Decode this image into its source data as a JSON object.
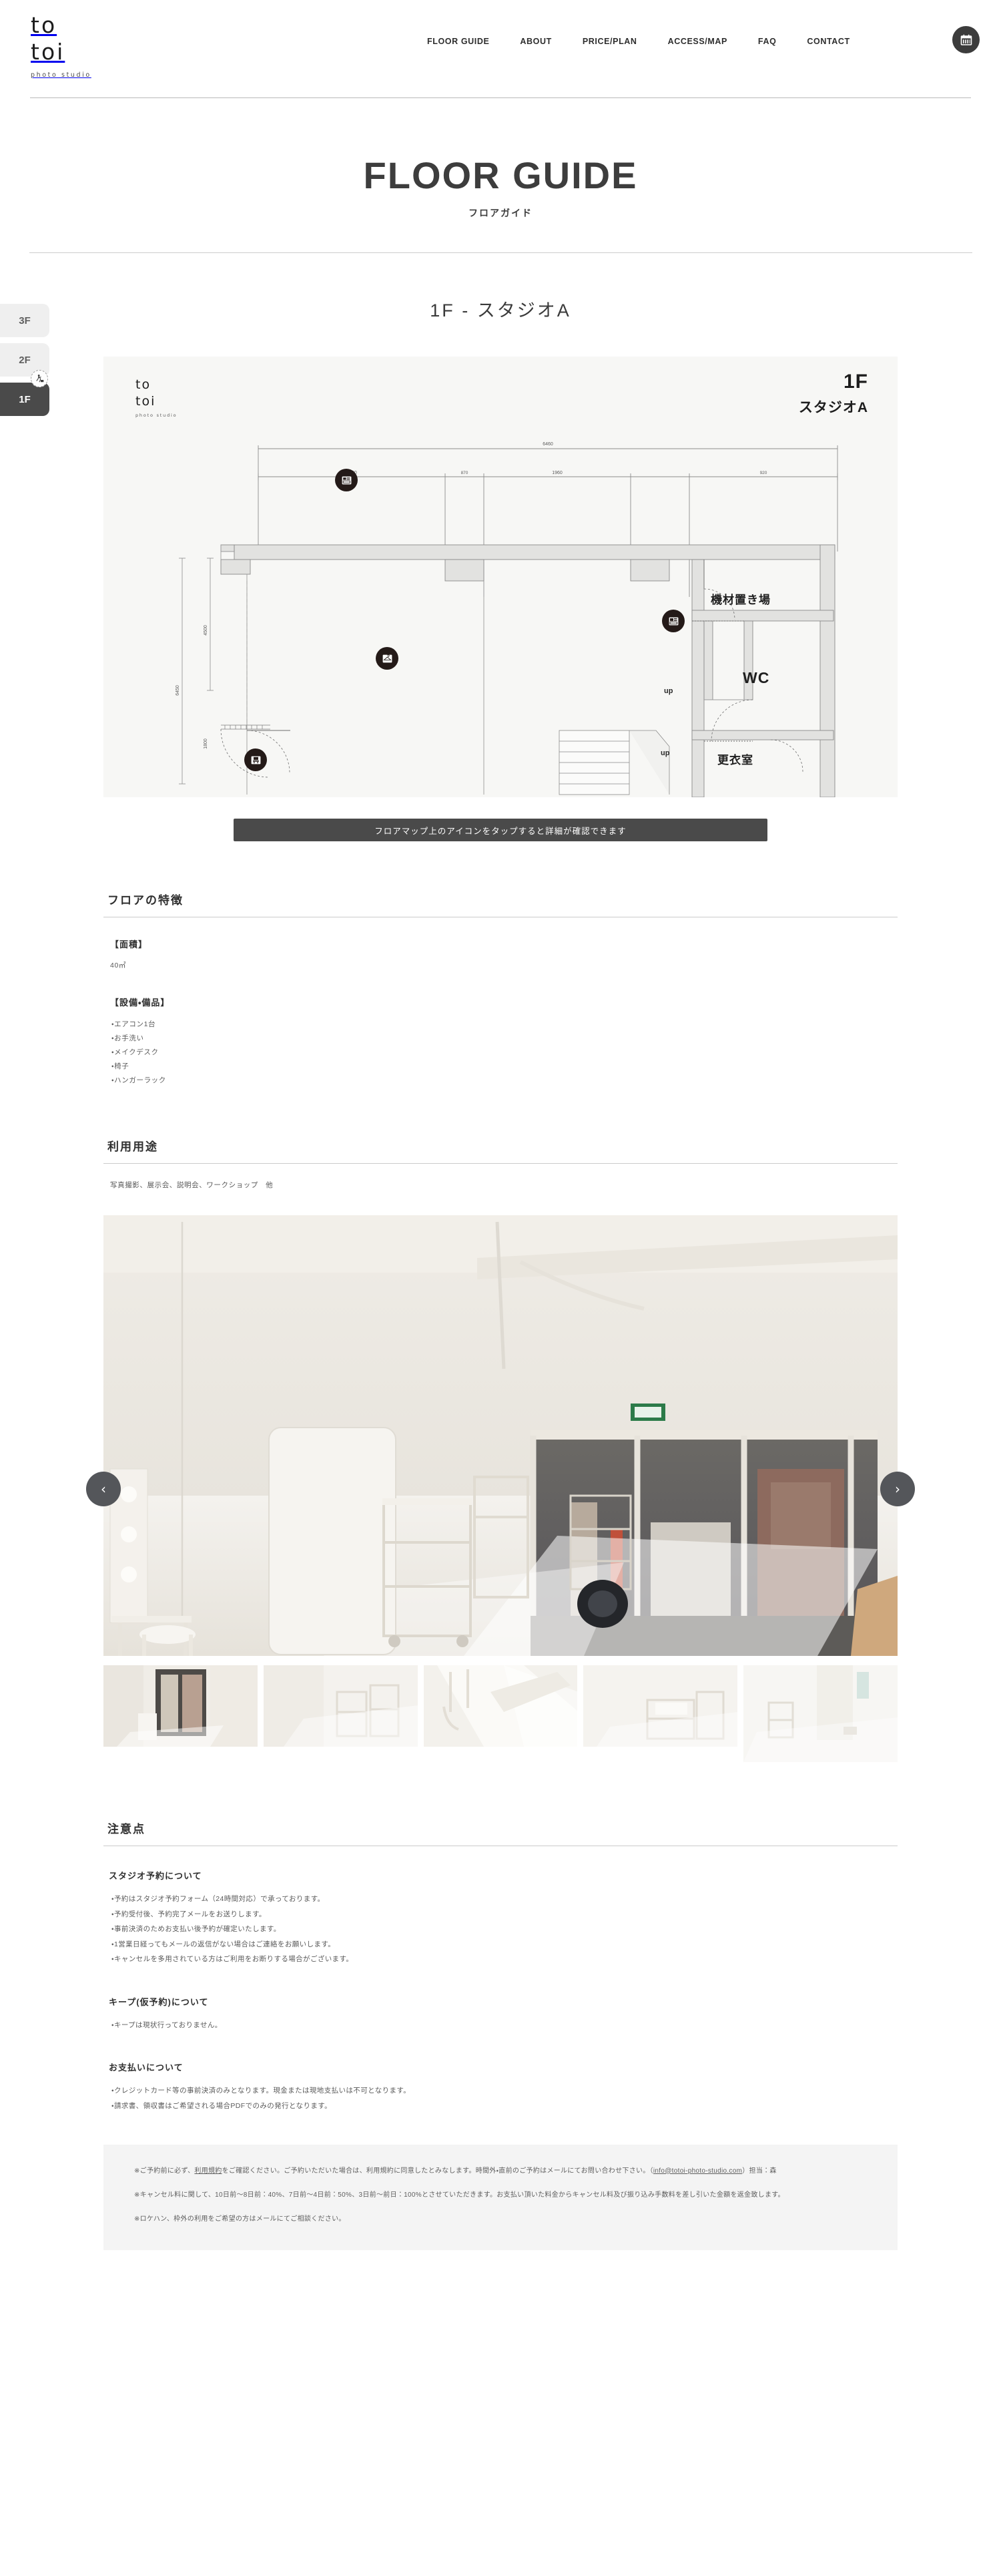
{
  "header": {
    "logo_line1": "to",
    "logo_line2": "toi",
    "logo_sub": "photo studio",
    "nav": [
      {
        "label": "FLOOR GUIDE"
      },
      {
        "label": "ABOUT"
      },
      {
        "label": "PRICE/PLAN"
      },
      {
        "label": "ACCESS/MAP"
      },
      {
        "label": "FAQ"
      },
      {
        "label": "CONTACT"
      }
    ],
    "reserve_icon": "calendar-icon"
  },
  "page": {
    "title": "FLOOR GUIDE",
    "subtitle": "フロアガイド"
  },
  "floor_tabs": [
    {
      "label": "3F",
      "active": false
    },
    {
      "label": "2F",
      "active": false
    },
    {
      "label": "1F",
      "active": true
    }
  ],
  "floor_section": {
    "title": "1F - スタジオA",
    "plan": {
      "logo_line1": "to",
      "logo_line2": "toi",
      "logo_sub": "photo studio",
      "floor_label": "1F",
      "room_label": "スタジオA",
      "rooms": [
        {
          "name": "機材置き場"
        },
        {
          "name": "WC"
        },
        {
          "name": "更衣室"
        }
      ],
      "stair_markers": [
        "up",
        "up"
      ],
      "dimensions": {
        "overall": "6460",
        "segments": [
          "2690",
          "870",
          "1960",
          "920"
        ],
        "side_overall": "6450",
        "side_segments": [
          "4500",
          "1800"
        ]
      },
      "pins": [
        {
          "name": "pin-makeup-desk"
        },
        {
          "name": "pin-hanger-rack"
        },
        {
          "name": "pin-equipment-storage"
        },
        {
          "name": "pin-chair"
        }
      ]
    },
    "tap_hint": "フロアマップ上のアイコンをタップすると詳細が確認できます"
  },
  "features": {
    "heading": "フロアの特徴",
    "area_label": "【面積】",
    "area_value": "40㎡",
    "equipment_label": "【設備・備品】",
    "equipment": [
      "・エアコン1台",
      "・お手洗い",
      "・メイクデスク",
      "・椅子",
      "・ハンガーラック"
    ]
  },
  "usage": {
    "heading": "利用用途",
    "text": "写真撮影、展示会、説明会、ワークショップ　他"
  },
  "gallery": {
    "prev_label": "‹",
    "next_label": "›",
    "thumb_count": 5
  },
  "notes": {
    "heading": "注意点",
    "groups": [
      {
        "title": "スタジオ予約について",
        "items": [
          "・予約はスタジオ予約フォーム（24時間対応）で承っております。",
          "・予約受付後、予約完了メールをお送りします。",
          "・事前決済のためお支払い後予約が確定いたします。",
          "・1営業日経ってもメールの返信がない場合はご連絡をお願いします。",
          "・キャンセルを多用されている方はご利用をお断りする場合がございます。"
        ]
      },
      {
        "title": "キープ(仮予約)について",
        "items": [
          "・キープは現状行っておりません。"
        ]
      },
      {
        "title": "お支払いについて",
        "items": [
          "・クレジットカード等の事前決済のみとなります。現金または現地支払いは不可となります。",
          "・請求書、領収書はご希望される場合PDFでのみの発行となります。"
        ]
      }
    ],
    "disclaimer": {
      "p1_pre": "※ご予約前に必ず、",
      "p1_link": "利用規約",
      "p1_mid": "をご確認ください。ご予約いただいた場合は、利用規約に同意したとみなします。時間外・直前のご予約はメールにてお問い合わせ下さい。（",
      "p1_email": "info@totoi-photo-studio.com",
      "p1_post": "）担当：森",
      "p2": "※キャンセル料に関して、10日前〜8日前：40%、7日前〜4日前：50%、3日前〜前日：100%とさせていただきます。お支払い頂いた料金からキャンセル料及び振り込み手数料を差し引いた金額を返金致します。",
      "p3": "※ロケハン、枠外の利用をご希望の方はメールにてご相談ください。"
    }
  },
  "colors": {
    "accent_dark": "#4a4a4a",
    "pin": "#241a18",
    "panel_bg": "#f7f7f5",
    "disclaimer_bg": "#f4f4f4"
  }
}
